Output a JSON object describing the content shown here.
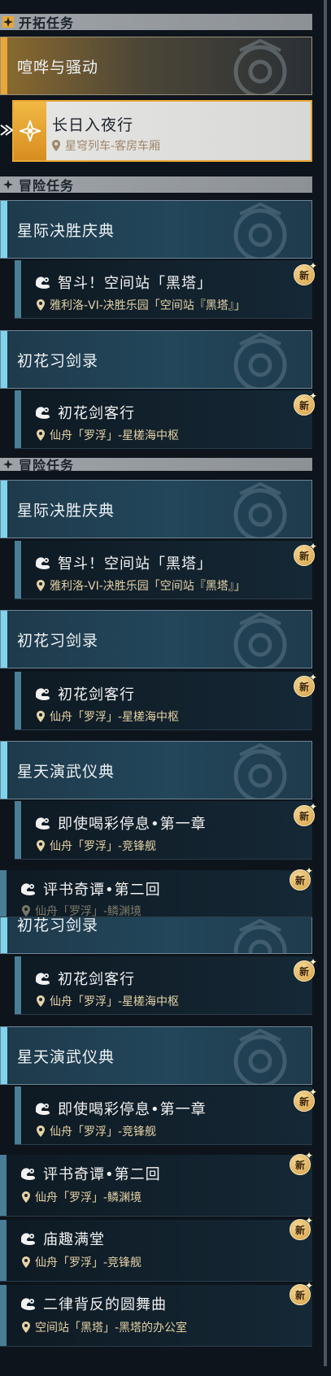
{
  "trailblaze": {
    "header": "开拓任务",
    "chapter": "喧哗与骚动",
    "active_quest": {
      "title": "长日入夜行",
      "location": "星穹列车-客房车厢"
    }
  },
  "adventure_header": "冒险任务",
  "new_badge": "新",
  "block1": {
    "c1": "星际决胜庆典",
    "q1": {
      "title": "智斗！空间站「黑塔」",
      "location": "雅利洛-VI-决胜乐园「空间站『黑塔』」"
    },
    "c2": "初花习剑录",
    "q2": {
      "title": "初花剑客行",
      "location": "仙舟「罗浮」-星槎海中枢"
    }
  },
  "block2": {
    "c1": "星际决胜庆典",
    "q1": {
      "title": "智斗！空间站「黑塔」",
      "location": "雅利洛-VI-决胜乐园「空间站『黑塔』」"
    },
    "c2": "初花习剑录",
    "q2": {
      "title": "初花剑客行",
      "location": "仙舟「罗浮」-星槎海中枢"
    },
    "c3": "星天演武仪典",
    "q3": {
      "title": "即使喝彩停息•第一章",
      "location": "仙舟「罗浮」-竞锋舰"
    },
    "q4": {
      "title": "评书奇谭•第二回",
      "location": "仙舟「罗浮」-鳞渊境"
    }
  },
  "block3": {
    "c2": "初花习剑录",
    "q2": {
      "title": "初花剑客行",
      "location": "仙舟「罗浮」-星槎海中枢"
    },
    "c3": "星天演武仪典",
    "q3": {
      "title": "即使喝彩停息•第一章",
      "location": "仙舟「罗浮」-竞锋舰"
    },
    "q4": {
      "title": "评书奇谭•第二回",
      "location": "仙舟「罗浮」-鳞渊境"
    },
    "q5": {
      "title": "庙趣满堂",
      "location": "仙舟「罗浮」-竞锋舰"
    },
    "q6": {
      "title": "二律背反的圆舞曲",
      "location": "空间站「黑塔」-黑塔的办公室"
    }
  },
  "colors": {
    "gold": "#e8a736",
    "accent": "#7fd4ec",
    "location": "#e5d2a6"
  }
}
